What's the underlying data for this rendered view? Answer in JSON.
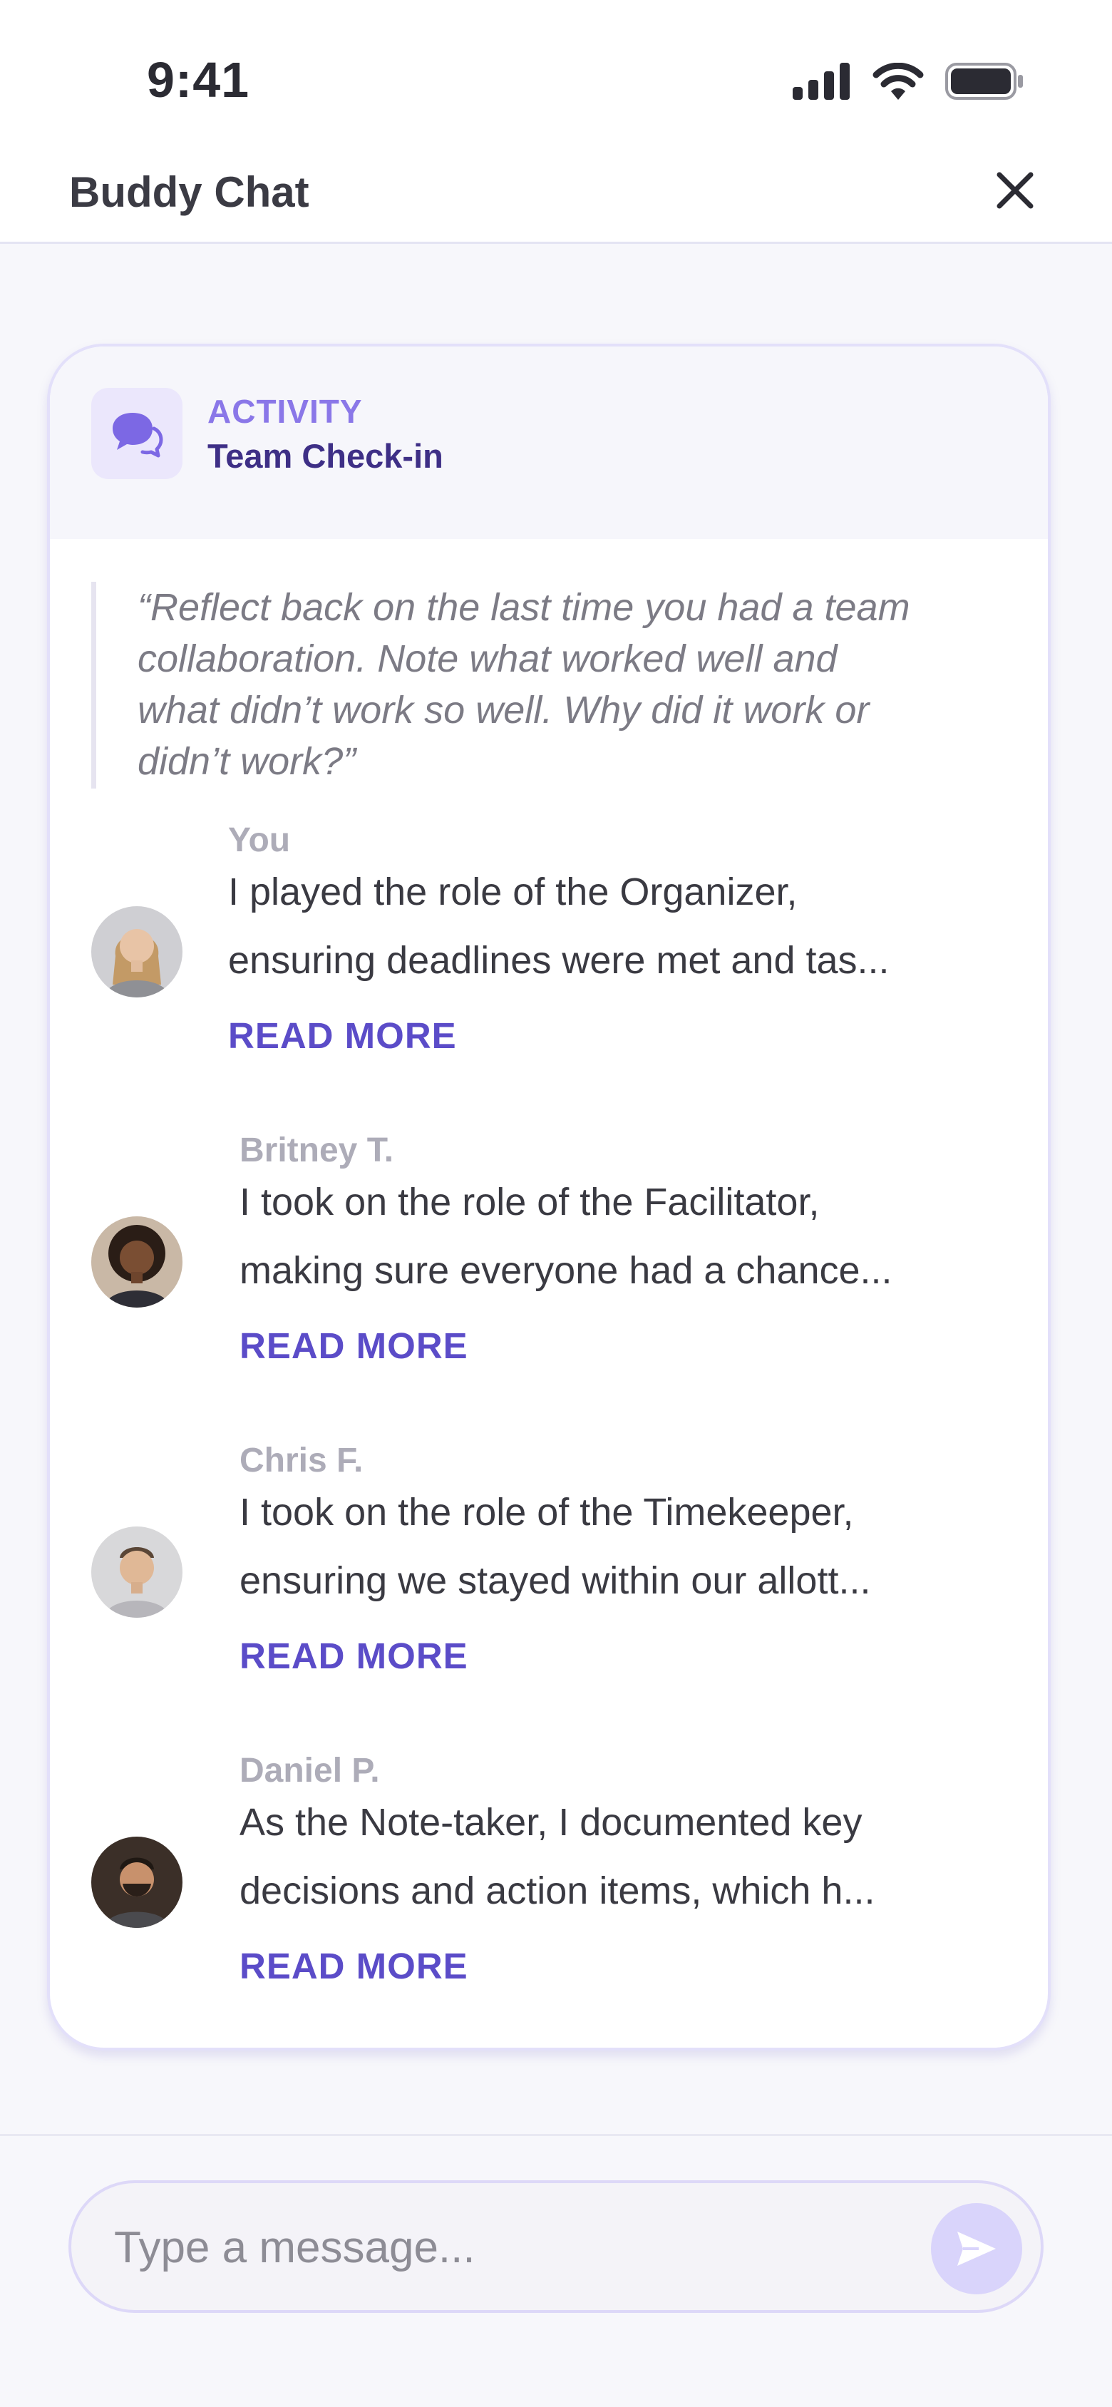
{
  "status_bar": {
    "time": "9:41",
    "icons": [
      "signal-icon",
      "wifi-icon",
      "battery-icon"
    ]
  },
  "header": {
    "title": "Buddy Chat",
    "close_icon": "close-icon"
  },
  "card": {
    "icon": "chat-bubbles-icon",
    "type_label": "ACTIVITY",
    "name": "Team Check-in",
    "prompt_lines": [
      "“Reflect back on the last time you had a team",
      "collaboration. Note what worked well and",
      "what didn’t work so well. Why did it work or",
      "didn’t work?”"
    ],
    "responses": [
      {
        "author": "You",
        "line1": "I played the role of the Organizer,",
        "line2": "ensuring deadlines were met and tas...",
        "read_more": "READ MORE"
      },
      {
        "author": "Britney T.",
        "line1": "I took on the role of the Facilitator,",
        "line2": "making sure everyone had a chance...",
        "read_more": "READ MORE"
      },
      {
        "author": "Chris F.",
        "line1": "I took on the role of the Timekeeper,",
        "line2": "ensuring we stayed within our allott...",
        "read_more": "READ MORE"
      },
      {
        "author": "Daniel P.",
        "line1": "As the Note-taker, I documented key",
        "line2": "decisions and action items, which h...",
        "read_more": "READ MORE"
      }
    ]
  },
  "composer": {
    "placeholder": "Type a message...",
    "send_icon": "send-icon"
  },
  "colors": {
    "accent": "#5b4cc8",
    "accent_light": "#8a77e8",
    "card_border": "#e3e0fa"
  }
}
